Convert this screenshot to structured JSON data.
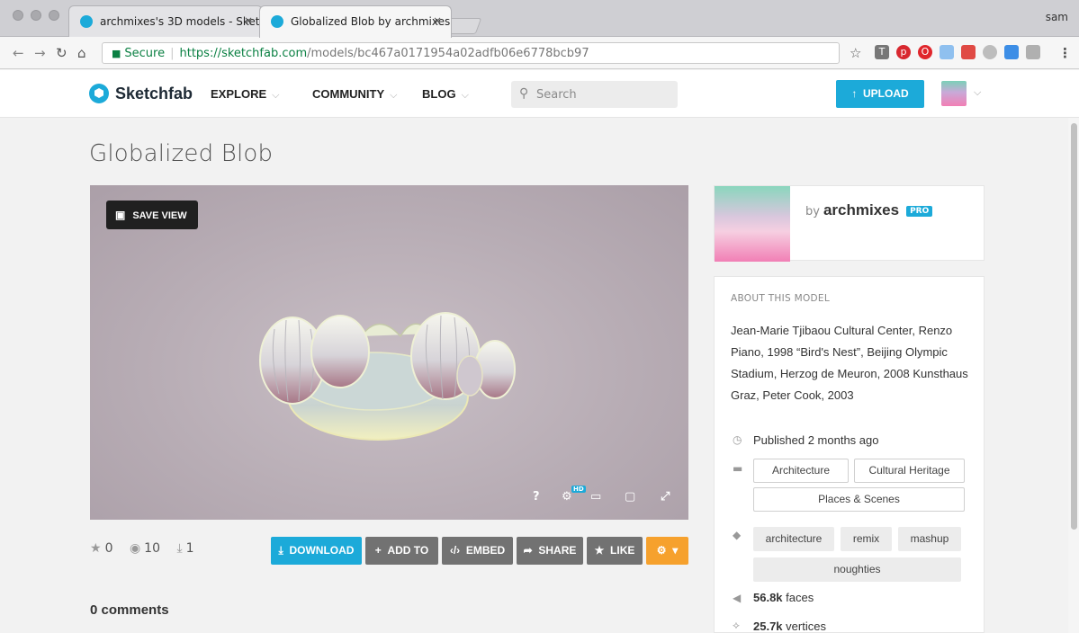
{
  "browser": {
    "tabs": [
      {
        "label": "archmixes's 3D models - Sket"
      },
      {
        "label": "Globalized Blob by archmixes"
      }
    ],
    "tab_close": "×",
    "profile_name": "sam",
    "secure_label": "Secure",
    "url_domain": "https://sketchfab.com",
    "url_path": "/models/bc467a0171954a02adfb06e6778bcb97"
  },
  "header": {
    "logo_text": "Sketchfab",
    "nav": [
      {
        "label": "EXPLORE"
      },
      {
        "label": "COMMUNITY"
      },
      {
        "label": "BLOG"
      }
    ],
    "search_placeholder": "Search",
    "upload_label": "UPLOAD"
  },
  "model": {
    "title": "Globalized Blob",
    "save_view_label": "SAVE VIEW",
    "hd_badge": "HD",
    "help_label": "?",
    "stats": {
      "likes": "0",
      "views": "10",
      "downloads": "1"
    },
    "actions": {
      "download": "DOWNLOAD",
      "add_to": "ADD TO",
      "embed": "EMBED",
      "share": "SHARE",
      "like": "LIKE"
    },
    "comments_label": "0 comments"
  },
  "author": {
    "by": "by",
    "name": "archmixes",
    "badge": "PRO"
  },
  "about": {
    "heading": "ABOUT THIS MODEL",
    "description": "Jean-Marie Tjibaou Cultural Center, Renzo Piano, 1998 “Bird's Nest”, Beijing Olympic Stadium, Herzog de Meuron, 2008 Kunsthaus Graz, Peter Cook, 2003",
    "published": "Published 2 months ago",
    "categories": [
      "Architecture",
      "Cultural Heritage",
      "Places & Scenes"
    ],
    "tags": [
      "architecture",
      "remix",
      "mashup",
      "noughties"
    ],
    "faces_value": "56.8k",
    "faces_label": " faces",
    "vertices_value": "25.7k",
    "vertices_label": " vertices"
  },
  "colors": {
    "accent": "#1caad9",
    "button_grey": "#727272",
    "button_orange": "#f6a12d"
  }
}
